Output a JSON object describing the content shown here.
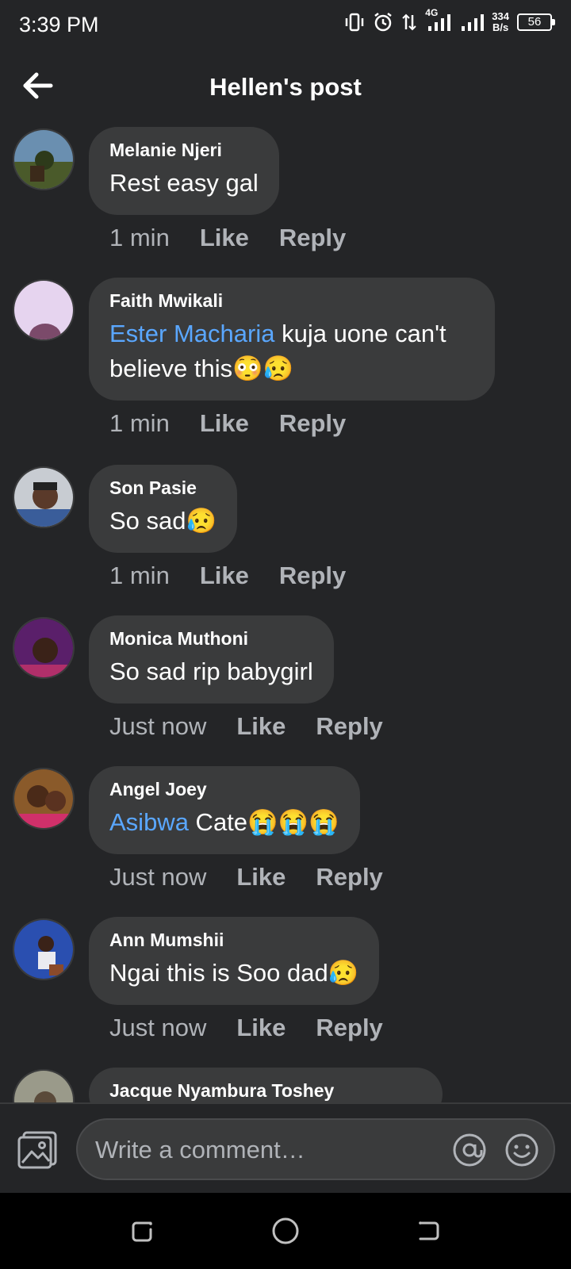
{
  "status_bar": {
    "time": "3:39 PM",
    "net_speed_value": "334",
    "net_speed_unit": "B/s",
    "battery": "56",
    "network": "4G"
  },
  "header": {
    "title": "Hellen's post",
    "back_icon": "arrow-left-icon"
  },
  "comments": [
    {
      "author": "Melanie Njeri",
      "mention": "",
      "text": "Rest easy gal",
      "time": "1 min",
      "like": "Like",
      "reply": "Reply"
    },
    {
      "author": "Faith Mwikali",
      "mention": "Ester Macharia",
      "text": " kuja uone can't believe this😳😥",
      "time": "1 min",
      "like": "Like",
      "reply": "Reply"
    },
    {
      "author": "Son Pasie",
      "mention": "",
      "text": "So sad😥",
      "time": "1 min",
      "like": "Like",
      "reply": "Reply"
    },
    {
      "author": "Monica Muthoni",
      "mention": "",
      "text": "So sad rip babygirl",
      "time": "Just now",
      "like": "Like",
      "reply": "Reply"
    },
    {
      "author": "Angel Joey",
      "mention": "Asibwa",
      "text": " Cate😭😭😭",
      "time": "Just now",
      "like": "Like",
      "reply": "Reply"
    },
    {
      "author": "Ann Mumshii",
      "mention": "",
      "text": "Ngai this is Soo dad😥",
      "time": "Just now",
      "like": "Like",
      "reply": "Reply"
    },
    {
      "author": "Jacque Nyambura Toshey",
      "mention": "",
      "text": "",
      "time": "",
      "like": "",
      "reply": ""
    }
  ],
  "composer": {
    "placeholder": "Write a comment…",
    "photo_icon": "photo-icon",
    "mention_icon": "at-sign-icon",
    "emoji_icon": "emoji-icon"
  },
  "colors": {
    "background": "#242527",
    "bubble": "#3a3b3c",
    "mention": "#5aa7ff",
    "secondary_text": "#b0b3b8"
  }
}
